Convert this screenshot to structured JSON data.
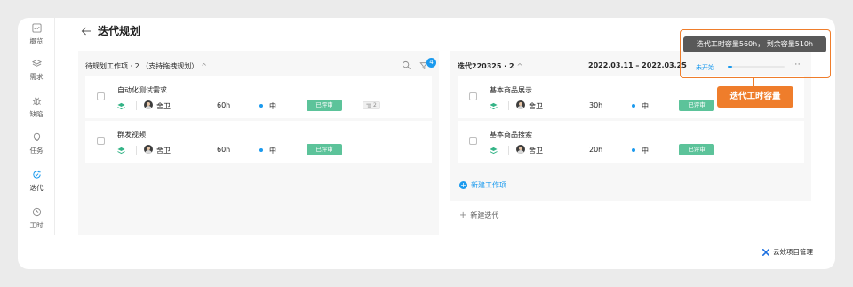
{
  "page": {
    "title": "迭代规划"
  },
  "sidebar": {
    "items": [
      {
        "label": "概览",
        "icon": "overview-icon"
      },
      {
        "label": "需求",
        "icon": "layers-icon"
      },
      {
        "label": "缺陷",
        "icon": "bug-icon"
      },
      {
        "label": "任务",
        "icon": "lightbulb-icon"
      },
      {
        "label": "迭代",
        "icon": "iteration-icon",
        "active": true
      },
      {
        "label": "工时",
        "icon": "clock-icon"
      }
    ]
  },
  "backlog": {
    "header": "待规划工作项 · 2 （支持拖拽规划）",
    "filter_count": "4",
    "items": [
      {
        "title": "自动化测试需求",
        "assignee": "舍卫",
        "hours": "60h",
        "priority": "中",
        "status": "已评审",
        "subtasks": "2"
      },
      {
        "title": "群发视频",
        "assignee": "舍卫",
        "hours": "60h",
        "priority": "中",
        "status": "已评审"
      }
    ]
  },
  "sprint": {
    "name": "迭代220325 · 2",
    "dates": "2022.03.11 – 2022.03.25",
    "status": "未开始",
    "capacity_fraction": 0.08,
    "more": "···",
    "items": [
      {
        "title": "基本商品展示",
        "assignee": "舍卫",
        "hours": "30h",
        "priority": "中",
        "status": "已评审"
      },
      {
        "title": "基本商品搜索",
        "assignee": "舍卫",
        "hours": "20h",
        "priority": "中",
        "status": "已评审"
      }
    ],
    "new_item_label": "新建工作项"
  },
  "new_sprint_label": "新建迭代",
  "tooltip": "迭代工时容量560h， 剩余容量510h",
  "callout": "迭代工时容量",
  "brand": "云效项目管理",
  "colors": {
    "accent": "#1b9aee",
    "status_green": "#5cc39a",
    "annotation": "#ef7d2b"
  }
}
